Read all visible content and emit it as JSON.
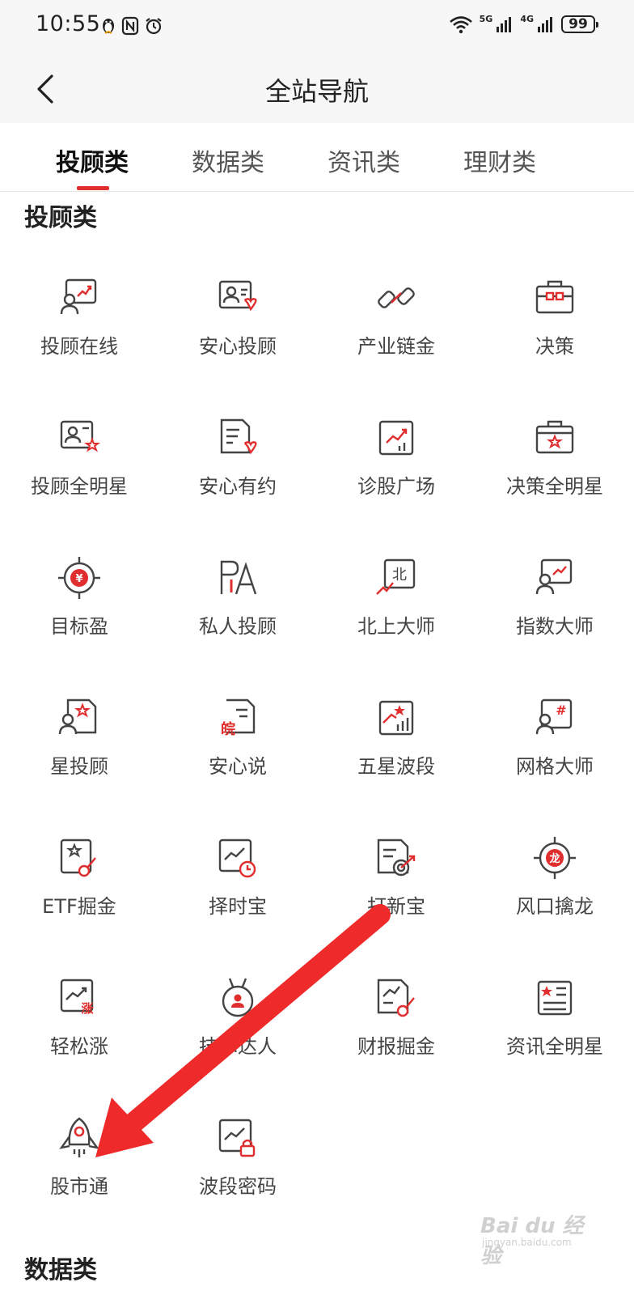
{
  "status_bar": {
    "time": "10:55",
    "signal_5g": "5G",
    "signal_4g": "4G",
    "battery": "99"
  },
  "header": {
    "title": "全站导航"
  },
  "tabs": [
    {
      "label": "投顾类",
      "active": true
    },
    {
      "label": "数据类",
      "active": false
    },
    {
      "label": "资讯类",
      "active": false
    },
    {
      "label": "理财类",
      "active": false
    }
  ],
  "sections": [
    {
      "title": "投顾类",
      "items": [
        {
          "label": "投顾在线",
          "icon": "advisor-online-icon"
        },
        {
          "label": "安心投顾",
          "icon": "secure-advisor-icon"
        },
        {
          "label": "产业链金",
          "icon": "industry-chain-icon"
        },
        {
          "label": "决策",
          "icon": "decision-briefcase-icon"
        },
        {
          "label": "投顾全明星",
          "icon": "advisor-allstar-icon"
        },
        {
          "label": "安心有约",
          "icon": "secure-appointment-icon"
        },
        {
          "label": "诊股广场",
          "icon": "stock-diagnosis-icon"
        },
        {
          "label": "决策全明星",
          "icon": "decision-allstar-icon"
        },
        {
          "label": "目标盈",
          "icon": "target-profit-icon"
        },
        {
          "label": "私人投顾",
          "icon": "private-advisor-icon"
        },
        {
          "label": "北上大师",
          "icon": "northbound-master-icon"
        },
        {
          "label": "指数大师",
          "icon": "index-master-icon"
        },
        {
          "label": "星投顾",
          "icon": "star-advisor-icon"
        },
        {
          "label": "安心说",
          "icon": "secure-talk-icon"
        },
        {
          "label": "五星波段",
          "icon": "five-star-band-icon"
        },
        {
          "label": "网格大师",
          "icon": "grid-master-icon"
        },
        {
          "label": "ETF掘金",
          "icon": "etf-gold-icon"
        },
        {
          "label": "择时宝",
          "icon": "timing-treasure-icon"
        },
        {
          "label": "打新宝",
          "icon": "ipo-treasure-icon"
        },
        {
          "label": "风口擒龙",
          "icon": "dragon-target-icon"
        },
        {
          "label": "轻松涨",
          "icon": "easy-rise-icon"
        },
        {
          "label": "技术达人",
          "icon": "tech-expert-icon"
        },
        {
          "label": "财报掘金",
          "icon": "earnings-gold-icon"
        },
        {
          "label": "资讯全明星",
          "icon": "news-allstar-icon"
        },
        {
          "label": "股市通",
          "icon": "rocket-icon"
        },
        {
          "label": "波段密码",
          "icon": "band-lock-icon"
        }
      ]
    },
    {
      "title": "数据类"
    }
  ],
  "icon_glyphs": {
    "dragon": "龙",
    "anhui": "皖",
    "north": "北",
    "rise": "涨",
    "yen": "¥",
    "hash": "#"
  },
  "watermark": {
    "brand": "Bai du 经验",
    "url": "jingyan.baidu.com"
  },
  "colors": {
    "accent": "#e02e2e",
    "icon_stroke": "#444444",
    "annotation_arrow": "#ee2a2a"
  }
}
